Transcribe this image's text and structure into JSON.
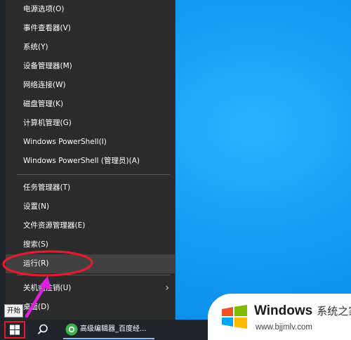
{
  "start_menu": {
    "items_group1": [
      {
        "label": "电源选项(O)"
      },
      {
        "label": "事件查看器(V)"
      },
      {
        "label": "系统(Y)"
      },
      {
        "label": "设备管理器(M)"
      },
      {
        "label": "网络连接(W)"
      },
      {
        "label": "磁盘管理(K)"
      },
      {
        "label": "计算机管理(G)"
      },
      {
        "label": "Windows PowerShell(I)"
      },
      {
        "label": "Windows PowerShell (管理员)(A)"
      }
    ],
    "items_group2": [
      {
        "label": "任务管理器(T)"
      },
      {
        "label": "设置(N)"
      },
      {
        "label": "文件资源管理器(E)"
      },
      {
        "label": "搜索(S)"
      },
      {
        "label": "运行(R)",
        "highlighted": true
      }
    ],
    "items_group3": [
      {
        "label": "关机或注销(U)",
        "has_submenu": true
      },
      {
        "label": "桌面(D)"
      }
    ]
  },
  "tooltip": {
    "text": "开始"
  },
  "taskbar": {
    "app_label": "高级编辑器_百度经...",
    "icons": [
      "windows-start-icon",
      "search-icon",
      "browser-icon"
    ]
  },
  "watermark": {
    "brand": "Windows",
    "brand_cn": "系统之家",
    "url": "www.bjjmlv.com"
  },
  "colors": {
    "menu_bg": "#2b2b2b",
    "highlight_bg": "#414141",
    "desktop_blue": "#139bf2",
    "annotation_red": "#e21b2f",
    "annotation_arrow": "#e020e0"
  }
}
